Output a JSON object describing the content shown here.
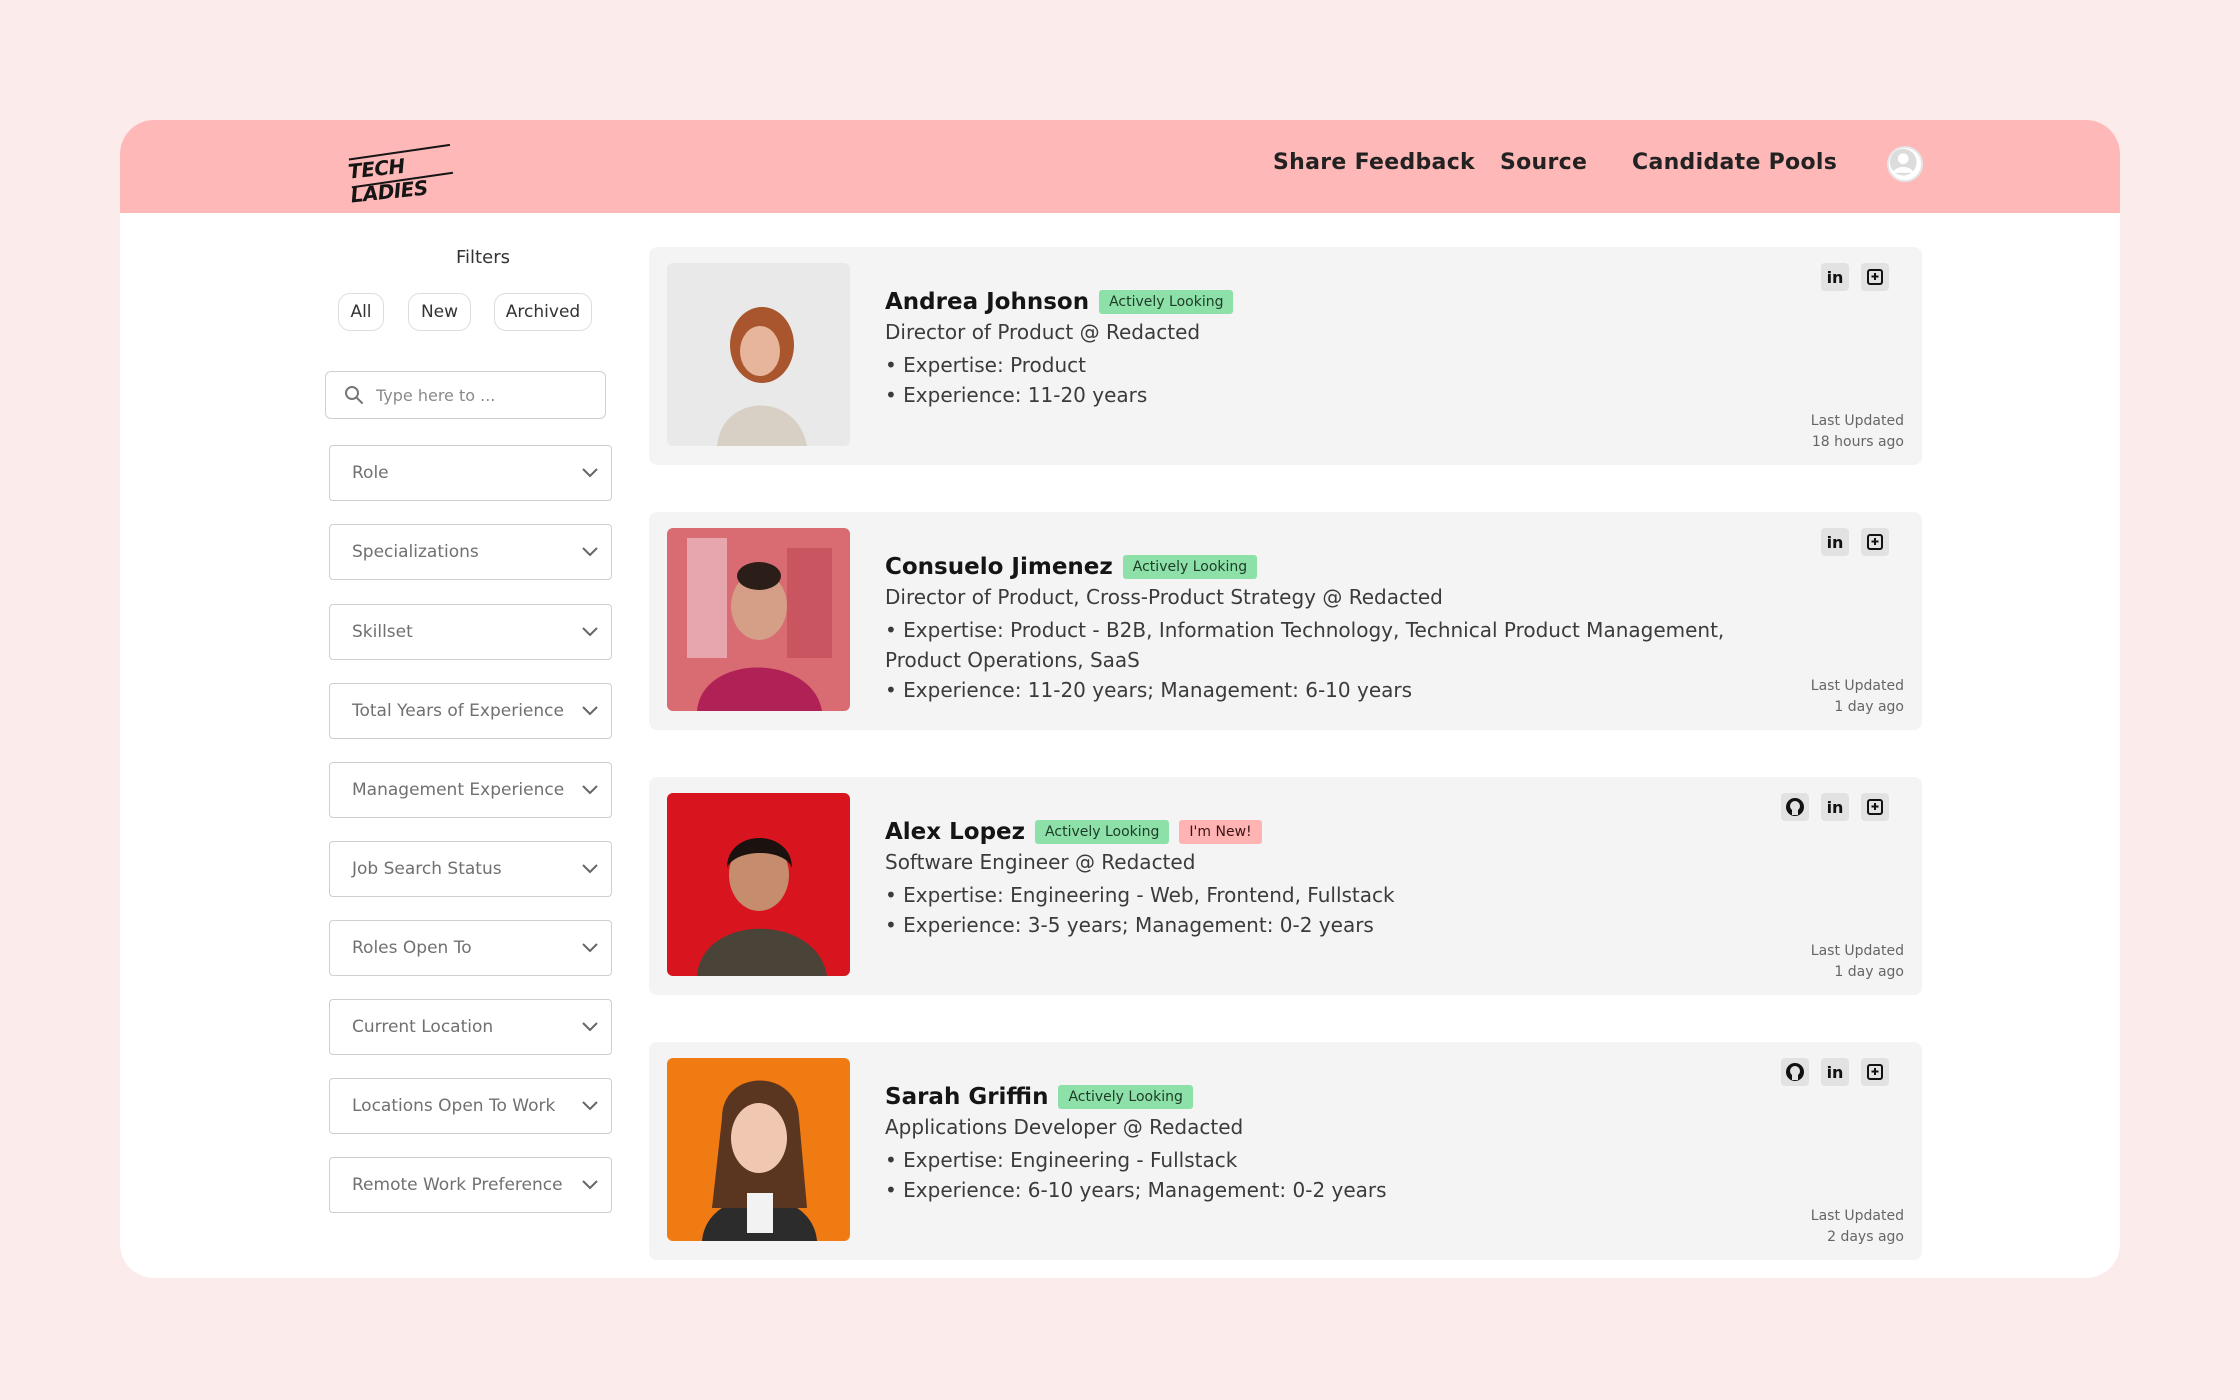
{
  "header": {
    "logo_text": "TECH LADIES",
    "nav": [
      {
        "label": "Share Feedback"
      },
      {
        "label": "Source"
      },
      {
        "label": "Candidate Pools"
      }
    ]
  },
  "sidebar": {
    "title": "Filters",
    "tabs": [
      {
        "label": "All"
      },
      {
        "label": "New"
      },
      {
        "label": "Archived"
      }
    ],
    "search_placeholder": "Type here to ...",
    "selects": [
      {
        "label": "Role"
      },
      {
        "label": "Specializations"
      },
      {
        "label": "Skillset"
      },
      {
        "label": "Total Years of Experience"
      },
      {
        "label": "Management Experience"
      },
      {
        "label": "Job Search Status"
      },
      {
        "label": "Roles Open To"
      },
      {
        "label": "Current Location"
      },
      {
        "label": "Locations Open To Work"
      },
      {
        "label": "Remote Work Preference"
      }
    ]
  },
  "candidates": [
    {
      "name": "Andrea Johnson",
      "badges": [
        "Actively Looking"
      ],
      "role": "Director of Product @ Redacted",
      "expertise": "• Expertise: Product",
      "experience": "• Experience: 11-20 years",
      "updated_label": "Last Updated",
      "updated_value": "18 hours ago",
      "icons": [
        "linkedin-icon",
        "resume-icon"
      ],
      "photo_bg": "#e9e9e9"
    },
    {
      "name": "Consuelo Jimenez",
      "badges": [
        "Actively Looking"
      ],
      "role": "Director of Product, Cross-Product Strategy @ Redacted",
      "expertise": "• Expertise: Product - B2B, Information Technology, Technical Product Management, Product Operations, SaaS",
      "experience": "• Experience: 11-20 years; Management: 6-10 years",
      "updated_label": "Last Updated",
      "updated_value": "1 day ago",
      "icons": [
        "linkedin-icon",
        "resume-icon"
      ],
      "photo_bg": "#d96b73"
    },
    {
      "name": "Alex Lopez",
      "badges": [
        "Actively Looking",
        "I'm New!"
      ],
      "role": "Software Engineer @ Redacted",
      "expertise": "• Expertise: Engineering - Web, Frontend, Fullstack",
      "experience": "• Experience: 3-5 years; Management: 0-2 years",
      "updated_label": "Last Updated",
      "updated_value": "1 day ago",
      "icons": [
        "github-icon",
        "linkedin-icon",
        "resume-icon"
      ],
      "photo_bg": "#d8141f"
    },
    {
      "name": "Sarah Griffin",
      "badges": [
        "Actively Looking"
      ],
      "role": "Applications Developer @ Redacted",
      "expertise": "• Expertise: Engineering - Fullstack",
      "experience": "• Experience: 6-10 years; Management: 0-2 years",
      "updated_label": "Last Updated",
      "updated_value": "2 days ago",
      "icons": [
        "github-icon",
        "linkedin-icon",
        "resume-icon"
      ],
      "photo_bg": "#f07b12"
    }
  ],
  "colors": {
    "page_bg": "#fcebeb",
    "header_bg": "#ffb8b8",
    "badge_active": "#8ee0a9",
    "badge_new": "#ffb3b3",
    "card_bg": "#f4f4f4"
  }
}
